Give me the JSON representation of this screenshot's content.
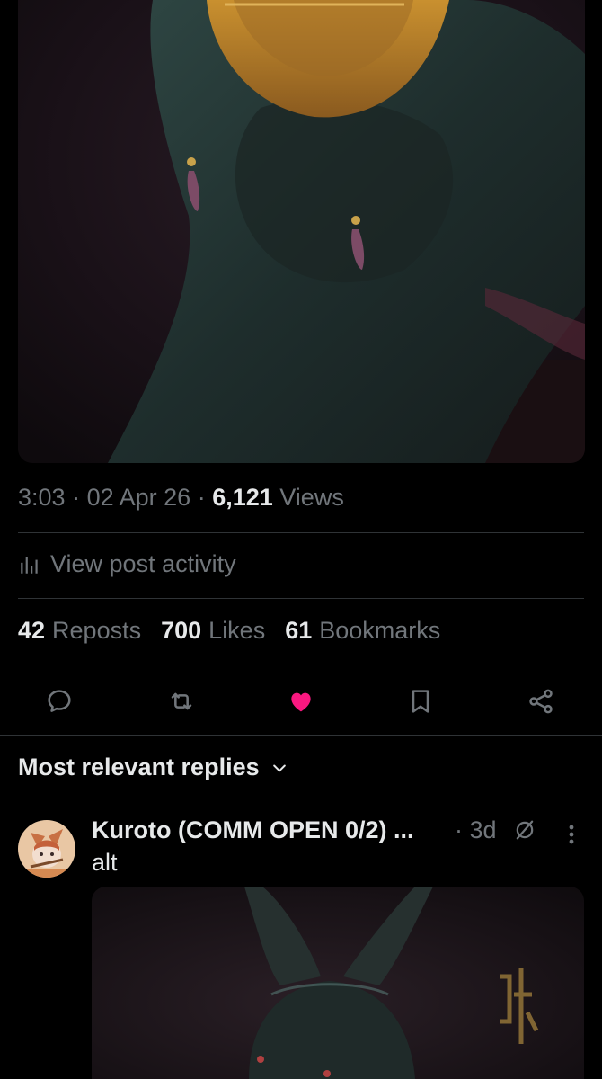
{
  "post": {
    "time": "3:03",
    "date": "02 Apr 26",
    "views_count": "6,121",
    "views_label": "Views",
    "activity_label": "View post activity",
    "stats": {
      "reposts_count": "42",
      "reposts_label": "Reposts",
      "likes_count": "700",
      "likes_label": "Likes",
      "bookmarks_count": "61",
      "bookmarks_label": "Bookmarks"
    },
    "liked": true
  },
  "replies": {
    "sort_label": "Most relevant replies",
    "items": [
      {
        "name": "Kuroto (COMM OPEN 0/2) ...",
        "age": "3d",
        "text": "alt"
      }
    ]
  },
  "colors": {
    "bg": "#000000",
    "text": "#e7e9ea",
    "muted": "#71767b",
    "divider": "#2f3336",
    "like": "#f91880"
  },
  "icons": [
    "comment-icon",
    "repost-icon",
    "heart-icon",
    "bookmark-icon",
    "share-icon",
    "analytics-icon",
    "chevron-down-icon",
    "no-grok-icon",
    "more-icon"
  ]
}
